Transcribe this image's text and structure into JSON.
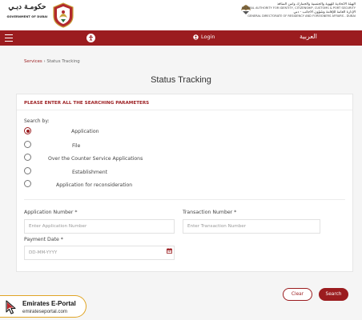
{
  "header": {
    "gov_logo_ar": "حكومـة دبـي",
    "gov_logo_en": "GOVERNMENT OF DUBAI",
    "gdrfa_lines": [
      "الهيئة الاتحادية للهوية والجنسية والجمارك وأمن المنافذ",
      "FEDERAL AUTHORITY FOR IDENTITY, CITIZENSHIP, CUSTOMS & PORT SECURITY",
      "الإدارة العامة للإقامة وشؤون الأجانب - دبي",
      "GENERAL DIRECTORATE OF RESIDENCY AND FOREIGNERS AFFAIRS - DUBAI"
    ]
  },
  "nav": {
    "login_label": "Login",
    "language_label": "العربية"
  },
  "breadcrumb": {
    "parent": "Services",
    "separator": "›",
    "current": "Status Tracking"
  },
  "page_title": "Status Tracking",
  "form": {
    "heading": "PLEASE ENTER ALL THE SEARCHING PARAMETERS",
    "search_by_label": "Search by:",
    "options": [
      {
        "label": "Application",
        "checked": true
      },
      {
        "label": "File",
        "checked": false
      },
      {
        "label": "Over the Counter Service Applications",
        "checked": false
      },
      {
        "label": "Establishment",
        "checked": false
      },
      {
        "label": "Application for reconsideration",
        "checked": false
      }
    ],
    "application_number": {
      "label": "Application Number *",
      "placeholder": "Enter Application Number"
    },
    "transaction_number": {
      "label": "Transaction Number *",
      "placeholder": "Enter Transaction Number"
    },
    "payment_date": {
      "label": "Payment Date *",
      "placeholder": "DD-MM-YYYY"
    }
  },
  "buttons": {
    "clear": "Clear",
    "search": "Search"
  },
  "watermark": {
    "title": "Emirates E-Portal",
    "url": "emirateseportal.com"
  },
  "colors": {
    "brand": "#9b1c1f",
    "watermark_border": "#e0a526"
  }
}
